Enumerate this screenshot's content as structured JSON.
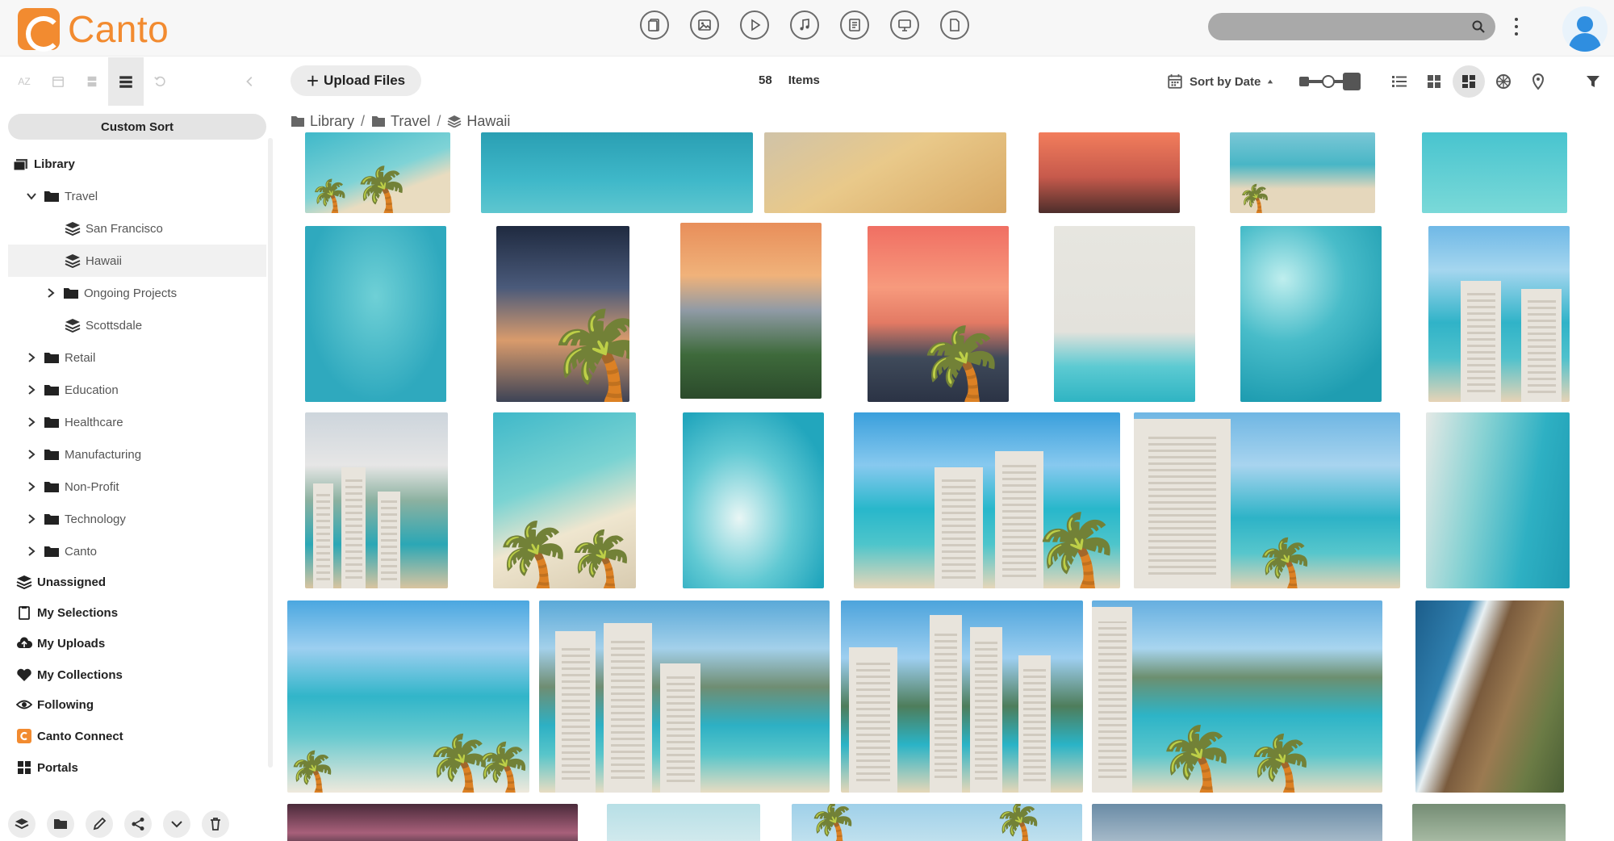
{
  "app": {
    "brand": "Canto"
  },
  "type_filters": [
    {
      "name": "documents-filter",
      "icon": "document-icon"
    },
    {
      "name": "images-filter",
      "icon": "image-icon"
    },
    {
      "name": "videos-filter",
      "icon": "play-icon"
    },
    {
      "name": "audio-filter",
      "icon": "music-icon"
    },
    {
      "name": "text-filter",
      "icon": "text-file-icon"
    },
    {
      "name": "presentations-filter",
      "icon": "presentation-icon"
    },
    {
      "name": "other-filter",
      "icon": "file-icon"
    }
  ],
  "search": {
    "placeholder": ""
  },
  "sidebar": {
    "tools": [
      "AZ",
      "calendar-icon",
      "database-icon",
      "custom-sort-icon",
      "undo-icon",
      "collapse-icon"
    ],
    "custom_sort": "Custom Sort",
    "tree": {
      "library": "Library",
      "travel": "Travel",
      "san_francisco": "San Francisco",
      "hawaii": "Hawaii",
      "ongoing_projects": "Ongoing Projects",
      "scottsdale": "Scottsdale",
      "retail": "Retail",
      "education": "Education",
      "healthcare": "Healthcare",
      "manufacturing": "Manufacturing",
      "non_profit": "Non-Profit",
      "technology": "Technology",
      "canto": "Canto"
    },
    "sections": {
      "unassigned": "Unassigned",
      "my_selections": "My Selections",
      "my_uploads": "My Uploads",
      "my_collections": "My Collections",
      "following": "Following",
      "canto_connect": "Canto Connect",
      "portals": "Portals"
    },
    "bottom_actions": [
      "new-album-icon",
      "new-folder-icon",
      "edit-icon",
      "share-icon",
      "more-icon",
      "trash-icon"
    ]
  },
  "toolbar": {
    "upload_label": "Upload Files",
    "item_count": "58",
    "items_label": "Items",
    "sort_label": "Sort by Date",
    "sort_direction": "ascending",
    "thumbnail_size_level": 0.5,
    "active_view": "masonry"
  },
  "breadcrumb": {
    "library": "Library",
    "travel": "Travel",
    "hawaii": "Hawaii"
  },
  "colors": {
    "brand": "#f28b30",
    "accent": "#2f8ee0",
    "ocean": "#3fb8c9"
  },
  "assets": [
    "beach-palms",
    "surfers-aerial",
    "golden-beach",
    "sunset-silhouette",
    "beach-pier",
    "turquoise-water",
    "kayakers-aerial",
    "palm-sunset",
    "city-valley-sunset",
    "palm-pink-sunset",
    "crowded-beach-aerial",
    "ocean-foam",
    "catamaran-beach",
    "waikiki-skyline",
    "palms-beach-aerial",
    "surfers-wave",
    "waikiki-hotels",
    "hotel-beach-diamondhead",
    "shallow-water-aerial",
    "beach-palms-diamondhead",
    "waikiki-aerial",
    "hotel-towers-beach",
    "waikiki-beach-panorama",
    "coastline-aerial",
    "pink-sky-palms",
    "pale-sky",
    "palm-fronds",
    "cloudy-coast",
    "green-hills"
  ]
}
